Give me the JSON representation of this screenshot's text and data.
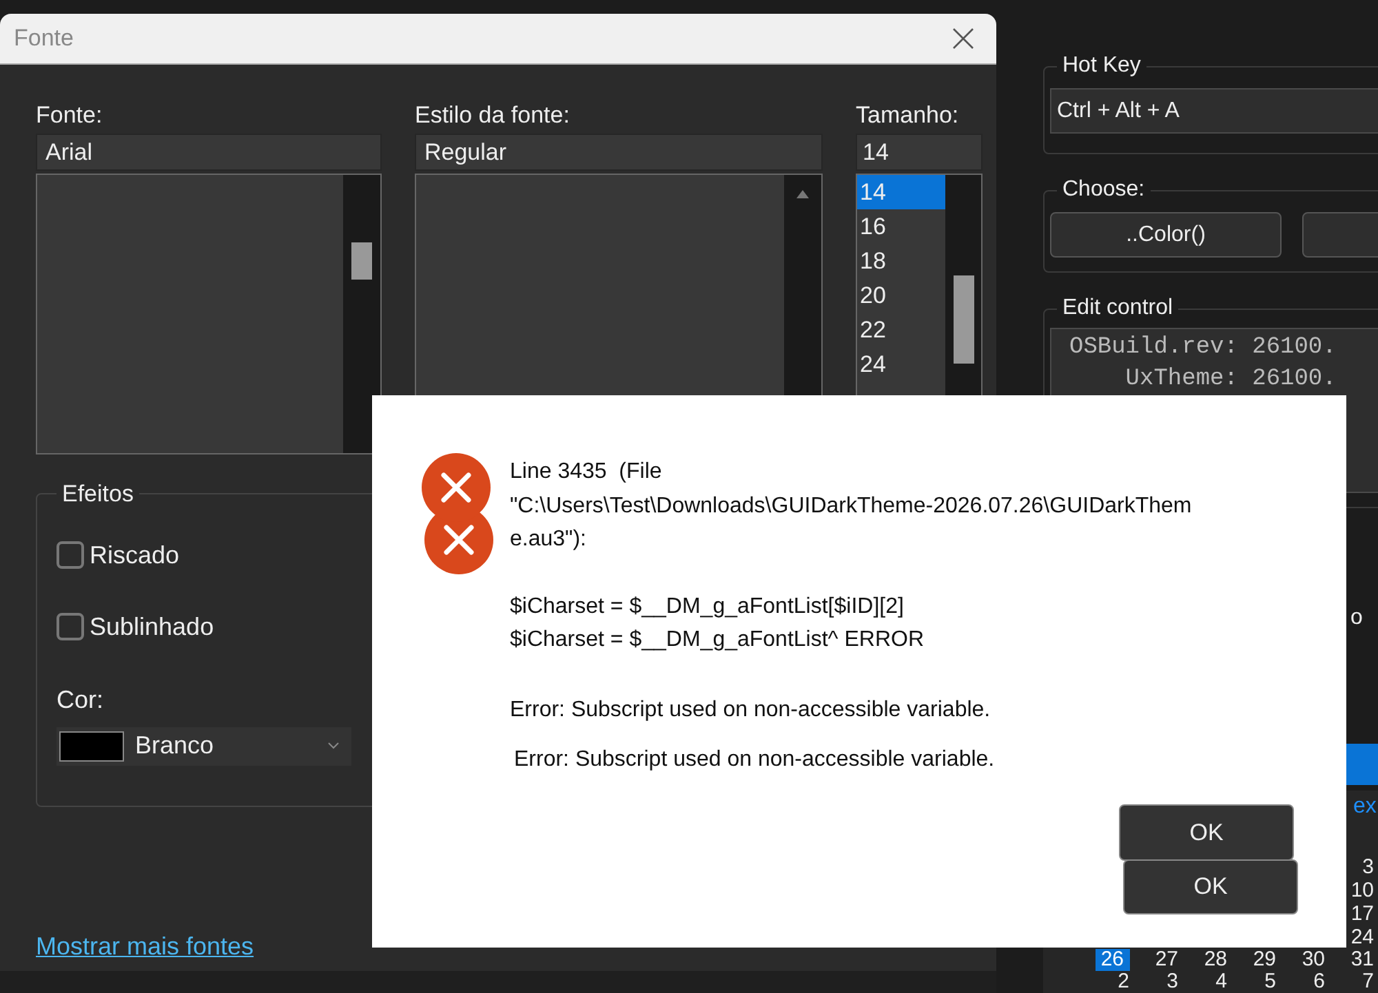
{
  "background_app": {
    "hot_key": {
      "title": "Hot Key",
      "value": "Ctrl + Alt + A"
    },
    "choose": {
      "title": "Choose:",
      "buttons": [
        "..Color()"
      ]
    },
    "edit_control": {
      "title": "Edit control",
      "lines": [
        "OSBuild.rev: 26100.",
        "    UxTheme: 26100."
      ]
    },
    "side_label": "o",
    "calendar": {
      "header_fragment": "ex",
      "last_column_days": [
        "3",
        "10",
        "17",
        "24"
      ],
      "weeks": [
        [
          {
            "day": "26",
            "selected": true
          },
          {
            "day": "27",
            "selected": false
          },
          {
            "day": "28",
            "selected": false
          },
          {
            "day": "29",
            "selected": false
          },
          {
            "day": "30",
            "selected": false
          },
          {
            "day": "31",
            "selected": false
          }
        ],
        [
          {
            "day": "2",
            "selected": false
          },
          {
            "day": "3",
            "selected": false
          },
          {
            "day": "4",
            "selected": false
          },
          {
            "day": "5",
            "selected": false
          },
          {
            "day": "6",
            "selected": false
          },
          {
            "day": "7",
            "selected": false
          }
        ]
      ]
    }
  },
  "font_dialog": {
    "title": "Fonte",
    "font": {
      "label": "Fonte:",
      "value": "Arial"
    },
    "style": {
      "label": "Estilo da fonte:",
      "value": "Regular"
    },
    "size": {
      "label": "Tamanho:",
      "value": "14",
      "items": [
        {
          "label": "14",
          "selected": true
        },
        {
          "label": "16",
          "selected": false
        },
        {
          "label": "18",
          "selected": false
        },
        {
          "label": "20",
          "selected": false
        },
        {
          "label": "22",
          "selected": false
        },
        {
          "label": "24",
          "selected": false
        }
      ]
    },
    "effects": {
      "title": "Efeitos",
      "checkboxes": [
        {
          "label": "Riscado",
          "checked": false
        },
        {
          "label": "Sublinhado",
          "checked": false
        }
      ],
      "color_label": "Cor:",
      "color": {
        "name": "Branco"
      }
    },
    "link": "Mostrar mais fontes"
  },
  "message_box": {
    "header_lines": [
      "Line 3435  (File",
      "\"C:\\Users\\Test\\Downloads\\GUIDarkTheme-2026.07.26\\GUIDarkThem",
      "e.au3\"):"
    ],
    "code_lines": [
      "$iCharset = $__DM_g_aFontList[$iID][2]",
      "$iCharset = $__DM_g_aFontList^ ERROR"
    ],
    "errors": [
      "Error: Subscript used on non-accessible variable.",
      "Error: Subscript used on non-accessible variable."
    ],
    "buttons": [
      "OK",
      "OK"
    ]
  }
}
